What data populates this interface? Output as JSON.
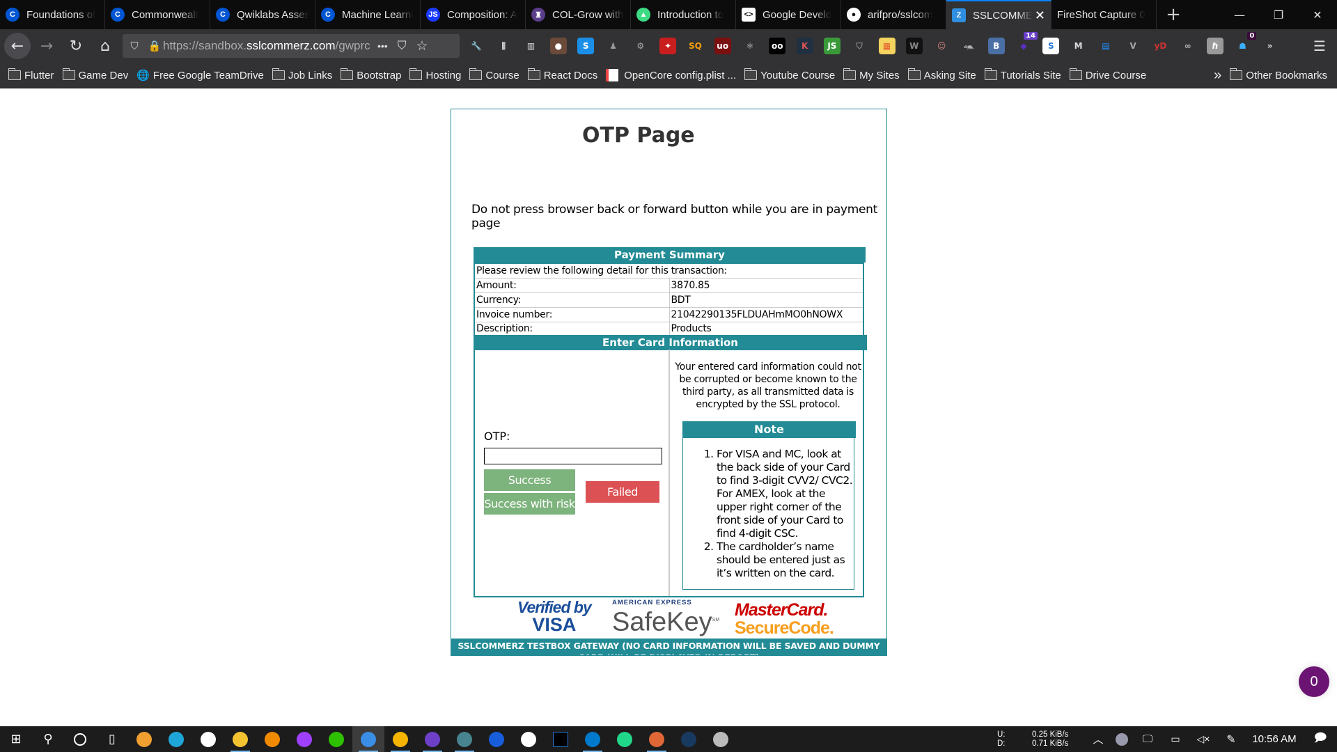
{
  "browser": {
    "tabs": [
      {
        "label": "Foundations of",
        "icon": "coursera-icon",
        "color": "#0056d2",
        "glyph": "C"
      },
      {
        "label": "Commonwealt",
        "icon": "coursera-icon",
        "color": "#0056d2",
        "glyph": "C"
      },
      {
        "label": "Qwiklabs Asses",
        "icon": "coursera-icon",
        "color": "#0056d2",
        "glyph": "C"
      },
      {
        "label": "Machine Learni",
        "icon": "coursera-icon",
        "color": "#0056d2",
        "glyph": "C"
      },
      {
        "label": "Composition: A",
        "icon": "js-icon",
        "color": "#1a3bff",
        "glyph": "JS"
      },
      {
        "label": "COL-Grow with",
        "icon": "university-crest-icon",
        "color": "#5a3e8a",
        "glyph": "♜"
      },
      {
        "label": "Introduction to",
        "icon": "android-icon",
        "color": "#3ddc84",
        "glyph": "▲"
      },
      {
        "label": "Google Develo",
        "icon": "google-developers-icon",
        "color": "#ffffff",
        "glyph": "<>"
      },
      {
        "label": "arifpro/sslcom",
        "icon": "github-icon",
        "color": "#ffffff",
        "glyph": "●"
      },
      {
        "label": "SSLCOMME",
        "icon": "sslcommerz-icon",
        "color": "#2f8ee0",
        "glyph": "Z",
        "active": true
      },
      {
        "label": "FireShot Capture 0",
        "icon": "",
        "color": "",
        "glyph": ""
      }
    ],
    "new_tab_glyph": "+",
    "window_controls": {
      "minimize": "—",
      "restore": "❐",
      "close": "✕"
    },
    "close_tab_glyph": "✕",
    "url": {
      "prefix": "https://sandbox.",
      "host": "sslcommerz.com",
      "suffix": "/gwprc"
    },
    "page_actions_glyph": "•••",
    "extension_badges": {
      "stack": "14",
      "ghostery": "0"
    },
    "bookmarks": [
      {
        "label": "Flutter",
        "icon": "folder-icon"
      },
      {
        "label": "Game Dev",
        "icon": "folder-icon"
      },
      {
        "label": "Free Google TeamDrive",
        "icon": "globe-icon"
      },
      {
        "label": "Job Links",
        "icon": "folder-icon"
      },
      {
        "label": "Bootstrap",
        "icon": "folder-icon"
      },
      {
        "label": "Hosting",
        "icon": "folder-icon"
      },
      {
        "label": "Course",
        "icon": "folder-icon"
      },
      {
        "label": "React Docs",
        "icon": "folder-icon"
      },
      {
        "label": "OpenCore config.plist ...",
        "icon": "opencore-icon"
      },
      {
        "label": "Youtube Course",
        "icon": "folder-icon"
      },
      {
        "label": "My Sites",
        "icon": "folder-icon"
      },
      {
        "label": "Asking Site",
        "icon": "folder-icon"
      },
      {
        "label": "Tutorials Site",
        "icon": "folder-icon"
      },
      {
        "label": "Drive Course",
        "icon": "folder-icon"
      }
    ],
    "bookmarks_overflow": "»",
    "other_bookmarks": "Other Bookmarks"
  },
  "page": {
    "title": "OTP Page",
    "warning": "Do not press browser back or forward button while you are in payment page",
    "summary": {
      "header": "Payment Summary",
      "intro": "Please review the following detail for this transaction:",
      "rows": [
        {
          "label": "Amount:",
          "value": "3870.85"
        },
        {
          "label": "Currency:",
          "value": "BDT"
        },
        {
          "label": "Invoice number:",
          "value": "21042290135FLDUAHmMO0hNOWX"
        },
        {
          "label": "Description:",
          "value": "Products"
        }
      ]
    },
    "card": {
      "header": "Enter Card Information",
      "otp_label": "OTP:",
      "otp_value": "",
      "buttons": {
        "success": "Success",
        "success_risk": "Success with risk",
        "failed": "Failed"
      },
      "secure_text": "Your entered card information could not be corrupted or become known to the third party, as all transmitted data is encrypted by the SSL protocol.",
      "note_header": "Note",
      "notes": [
        "For VISA and MC, look at the back side of your Card to find 3-digit CVV2/ CVC2. For AMEX, look at the upper right corner of the front side of your Card to find 4-digit CSC.",
        "The cardholder’s name should be entered just as it’s written on the card."
      ]
    },
    "logos": {
      "visa_line1": "Verified by",
      "visa_line2": "VISA",
      "amex_line1": "AMERICAN EXPRESS",
      "amex_line2": "SafeKey",
      "amex_sm": "SM",
      "mc_line1": "MasterCard.",
      "mc_line2": "SecureCode."
    },
    "footer": "SSLCOMMERZ TESTBOX GATEWAY (NO CARD INFORMATION WILL BE SAVED AND DUMMY CARD WILL BE DISPLAYED IN REPORT)",
    "chat_count": "0",
    "accent_color": "#228b95"
  },
  "taskbar": {
    "net_up_label": "U:",
    "net_up": "0.25 KiB/s",
    "net_down_label": "D:",
    "net_down": "0.71 KiB/s",
    "time": "10:56 AM"
  }
}
